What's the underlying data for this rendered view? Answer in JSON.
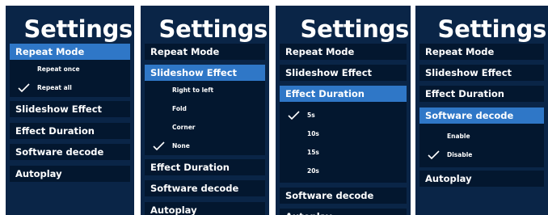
{
  "panels": [
    {
      "title": "Settings",
      "items": {
        "repeat_mode": "Repeat Mode",
        "repeat_once": "Repeat once",
        "repeat_all": "Repeat all",
        "slideshow_effect": "Slideshow Effect",
        "effect_duration": "Effect Duration",
        "software_decode": "Software decode",
        "autoplay": "Autoplay"
      },
      "selected": "Repeat all"
    },
    {
      "title": "Settings",
      "items": {
        "repeat_mode": "Repeat Mode",
        "slideshow_effect": "Slideshow Effect",
        "right_to_left": "Right to left",
        "fold": "Fold",
        "corner": "Corner",
        "none": "None",
        "effect_duration": "Effect Duration",
        "software_decode": "Software decode",
        "autoplay": "Autoplay"
      },
      "selected": "None"
    },
    {
      "title": "Settings",
      "items": {
        "repeat_mode": "Repeat Mode",
        "slideshow_effect": "Slideshow Effect",
        "effect_duration": "Effect Duration",
        "d5": "5s",
        "d10": "10s",
        "d15": "15s",
        "d20": "20s",
        "software_decode": "Software decode",
        "autoplay": "Autoplay"
      },
      "selected": "5s"
    },
    {
      "title": "Settings",
      "items": {
        "repeat_mode": "Repeat Mode",
        "slideshow_effect": "Slideshow Effect",
        "effect_duration": "Effect Duration",
        "software_decode": "Software decode",
        "enable": "Enable",
        "disable": "Disable",
        "autoplay": "Autoplay"
      },
      "selected": "Disable"
    }
  ],
  "colors": {
    "panel_bg": "#0a2547",
    "item_bg": "#03172f",
    "active_bg": "#2f77c7",
    "text": "#ffffff"
  },
  "icons": {
    "selected_marker": "checkmark-icon"
  }
}
